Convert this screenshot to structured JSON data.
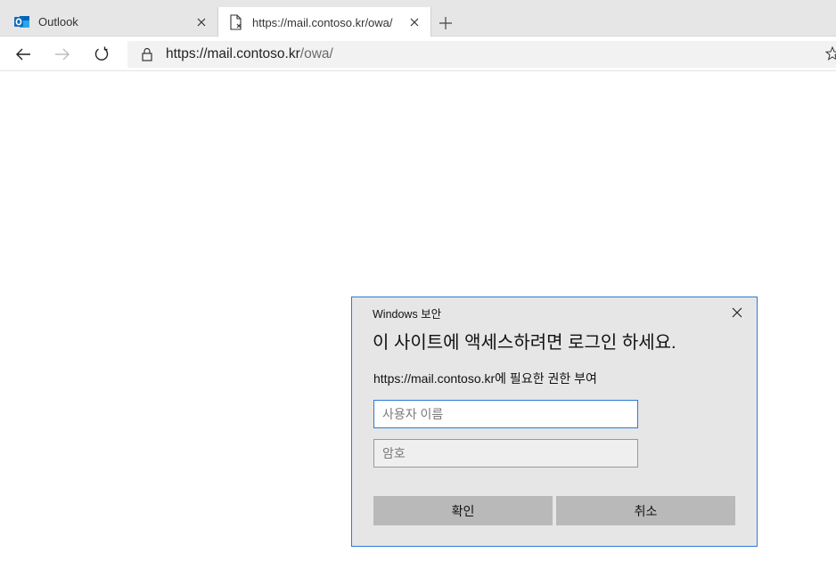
{
  "browser": {
    "tabs": [
      {
        "title": "Outlook",
        "icon": "outlook-icon",
        "active": false
      },
      {
        "title": "https://mail.contoso.kr/owa/",
        "icon": "page-error-icon",
        "active": true
      }
    ],
    "address": {
      "host": "https://mail.contoso.kr",
      "path": "/owa/"
    },
    "colors": {
      "accent": "#2b7bd6",
      "outlook_blue": "#0f6cbd"
    }
  },
  "dialog": {
    "caption": "Windows 보안",
    "heading": "이 사이트에 액세스하려면 로그인 하세요.",
    "description": "https://mail.contoso.kr에 필요한 권한 부여",
    "username_placeholder": "사용자 이름",
    "password_placeholder": "암호",
    "ok_label": "확인",
    "cancel_label": "취소"
  }
}
